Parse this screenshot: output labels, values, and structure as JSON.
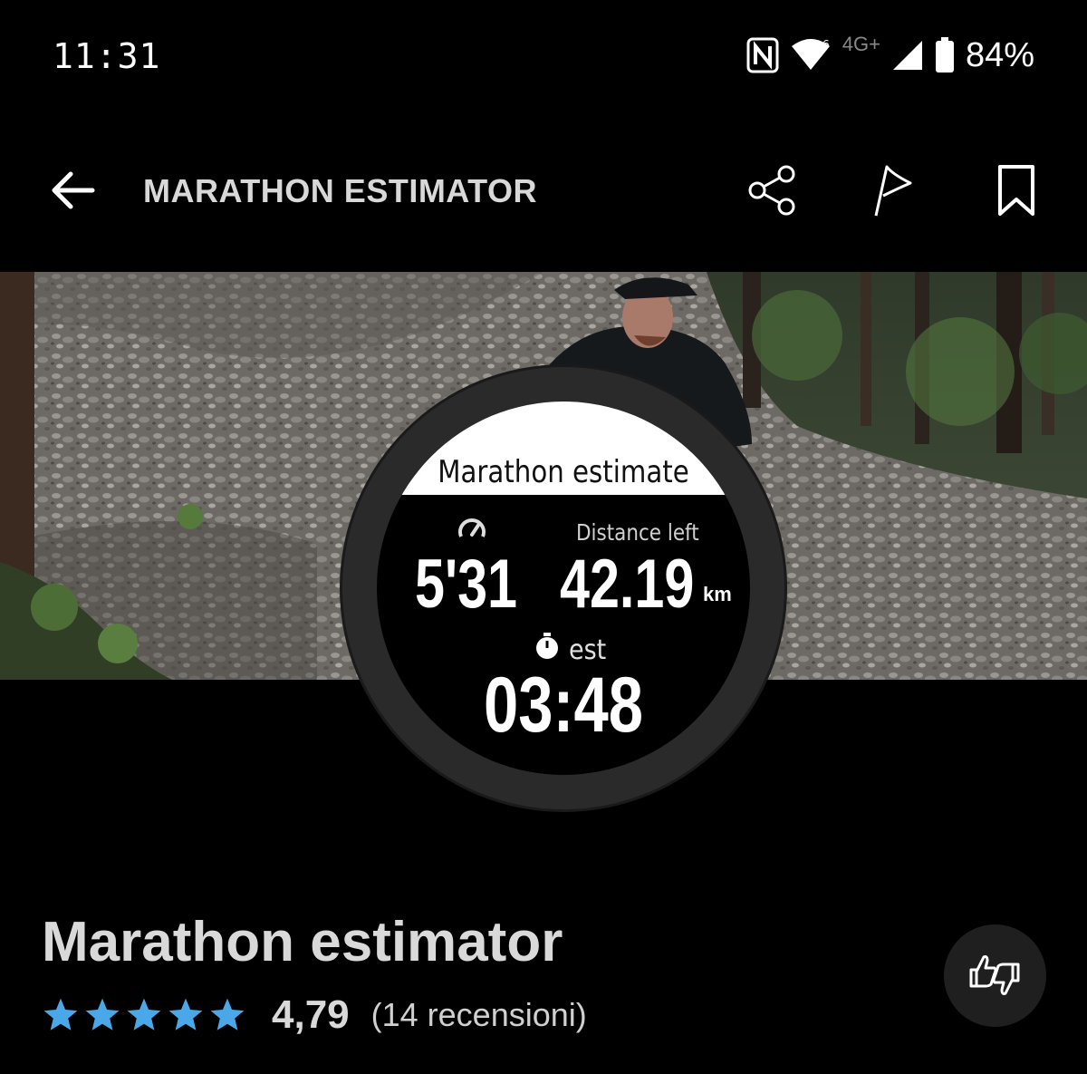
{
  "status_bar": {
    "time": "11:31",
    "network_label": "4G+",
    "battery": "84%",
    "icons": [
      "nfc-icon",
      "wifi-icon",
      "cellular-signal-icon",
      "battery-icon"
    ]
  },
  "app_bar": {
    "title": "MARATHON ESTIMATOR",
    "icons": [
      "back-arrow-icon",
      "share-icon",
      "flag-icon",
      "bookmark-icon"
    ]
  },
  "watch": {
    "header": "Marathon estimate",
    "pace": "5'31",
    "distance_label": "Distance left",
    "distance": "42.19",
    "distance_unit": "km",
    "est_label": "est",
    "estimated_time": "03:48"
  },
  "app_info": {
    "name": "Marathon estimator",
    "rating": "4,79",
    "reviews": "(14 recensioni)",
    "stars": 5
  },
  "colors": {
    "background": "#000000",
    "star": "#4aa8e8",
    "title_text": "#d9d9d9"
  }
}
